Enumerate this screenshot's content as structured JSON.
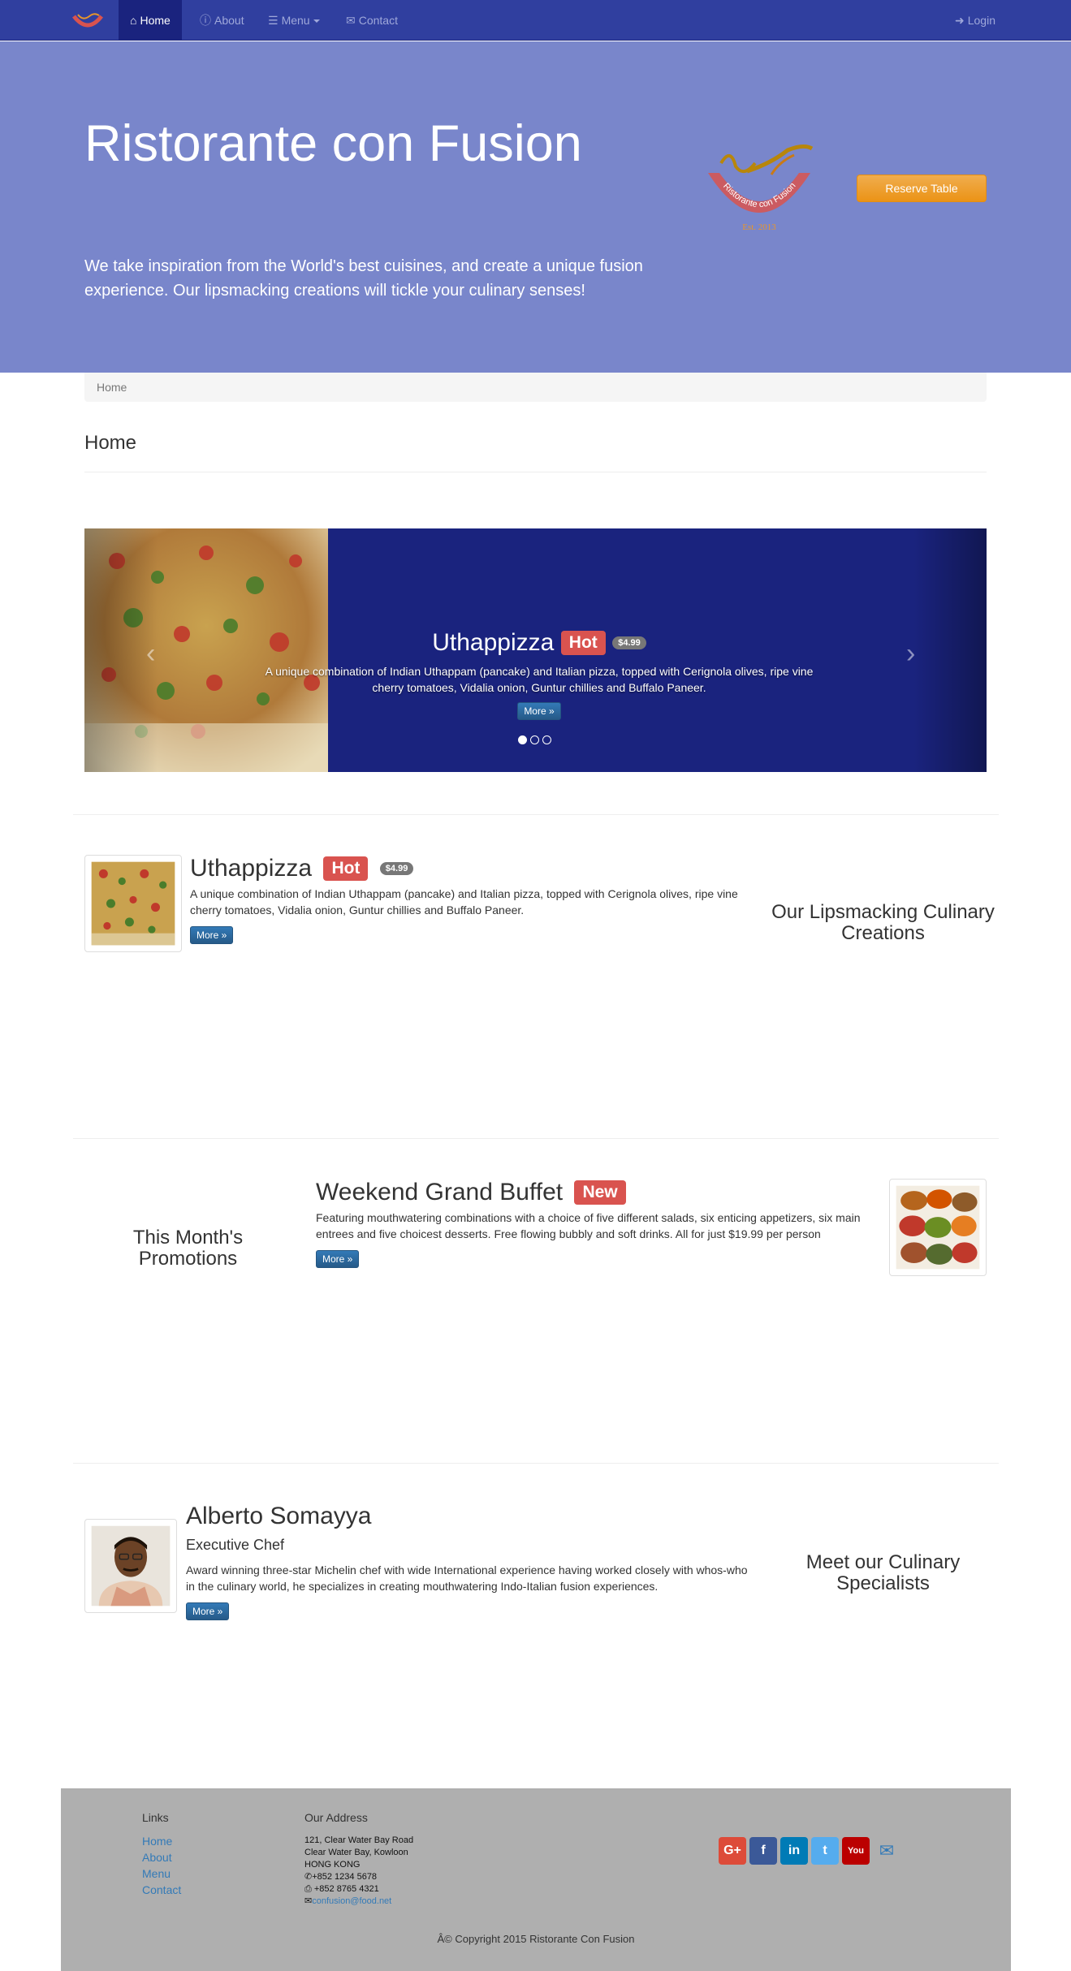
{
  "navbar": {
    "items": [
      {
        "label": "Home",
        "icon": "home-icon"
      },
      {
        "label": "About",
        "icon": "info-icon"
      },
      {
        "label": "Menu",
        "icon": "list-icon"
      },
      {
        "label": "Contact",
        "icon": "envelope-icon"
      }
    ],
    "login": "Login"
  },
  "jumbotron": {
    "title": "Ristorante con Fusion",
    "text": "We take inspiration from the World's best cuisines, and create a unique fusion experience. Our lipsmacking creations will tickle your culinary senses!",
    "reserve_label": "Reserve Table",
    "logo_text": "Ristorante con Fusion",
    "logo_est": "Est. 2013"
  },
  "breadcrumb": {
    "home": "Home"
  },
  "page_title": "Home",
  "carousel": {
    "title": "Uthappizza",
    "label": "Hot",
    "price": "$4.99",
    "description": "A unique combination of Indian Uthappam (pancake) and Italian pizza, topped with Cerignola olives, ripe vine cherry tomatoes, Vidalia onion, Guntur chillies and Buffalo Paneer.",
    "more": "More »",
    "slides": 3,
    "active_slide": 1
  },
  "dish": {
    "title": "Uthappizza",
    "label": "Hot",
    "price": "$4.99",
    "description": "A unique combination of Indian Uthappam (pancake) and Italian pizza, topped with Cerignola olives, ripe vine cherry tomatoes, Vidalia onion, Guntur chillies and Buffalo Paneer.",
    "more": "More »",
    "side_title": "Our Lipsmacking Culinary Creations"
  },
  "promotion": {
    "title": "Weekend Grand Buffet",
    "label": "New",
    "description": "Featuring mouthwatering combinations with a choice of five different salads, six enticing appetizers, six main entrees and five choicest desserts. Free flowing bubbly and soft drinks. All for just $19.99 per person",
    "more": "More »",
    "side_title": "This Month's Promotions"
  },
  "leader": {
    "name": "Alberto Somayya",
    "designation": "Executive Chef",
    "description": "Award winning three-star Michelin chef with wide International experience having worked closely with whos-who in the culinary world, he specializes in creating mouthwatering Indo-Italian fusion experiences.",
    "more": "More »",
    "side_title": "Meet our Culinary Specialists"
  },
  "footer": {
    "links_title": "Links",
    "links": [
      "Home",
      "About",
      "Menu",
      "Contact"
    ],
    "address_title": "Our Address",
    "address": [
      "121, Clear Water Bay Road",
      "Clear Water Bay, Kowloon",
      "HONG KONG"
    ],
    "phone": "+852 1234 5678",
    "fax": " +852 8765 4321",
    "email": "confusion@food.net",
    "social": [
      {
        "name": "google-plus",
        "glyph": "G+",
        "color": "#dd4b39"
      },
      {
        "name": "facebook",
        "glyph": "f",
        "color": "#3b5998"
      },
      {
        "name": "linkedin",
        "glyph": "in",
        "color": "#007bb6"
      },
      {
        "name": "twitter",
        "glyph": "t",
        "color": "#55acee"
      },
      {
        "name": "youtube",
        "glyph": "You",
        "color": "#bb0000"
      }
    ],
    "copyright": "Â© Copyright 2015 Ristorante Con Fusion"
  }
}
